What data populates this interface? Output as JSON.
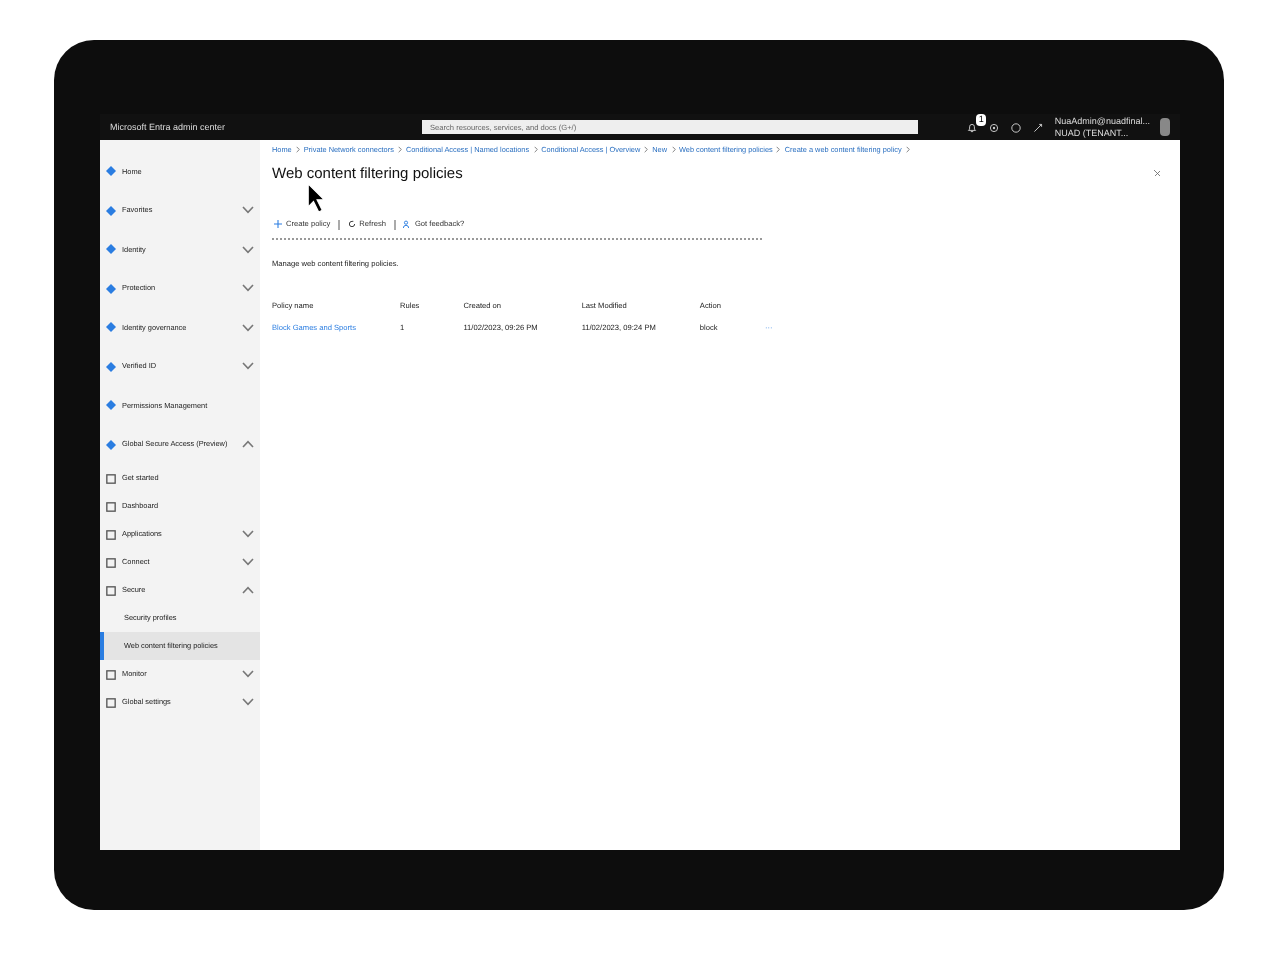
{
  "header": {
    "title": "Microsoft Entra admin center",
    "search": {
      "placeholder": "Search resources, services, and docs (G+/)"
    },
    "notification_count": "1",
    "account": {
      "name": "NuaAdmin@nuadfinal...",
      "tenant": "NUAD (TENANT..."
    }
  },
  "sidebar": {
    "items": [
      {
        "label": "Home",
        "selected": false
      },
      {
        "label": "Favorites",
        "selected": false,
        "expanded": false
      },
      {
        "label": "Identity",
        "selected": false,
        "expanded": false
      },
      {
        "label": "Protection",
        "selected": false,
        "expanded": false
      },
      {
        "label": "Identity governance",
        "selected": false,
        "expanded": false
      },
      {
        "label": "Verified ID",
        "selected": false,
        "expanded": false
      },
      {
        "label": "Permissions Management",
        "selected": false
      },
      {
        "label": "Global Secure Access (Preview)",
        "selected": false,
        "expanded": true,
        "children": [
          {
            "label": "Get started",
            "selected": false
          },
          {
            "label": "Dashboard",
            "selected": false
          },
          {
            "label": "Applications",
            "selected": false,
            "expanded": false
          },
          {
            "label": "Connect",
            "selected": false,
            "expanded": false
          },
          {
            "label": "Secure",
            "selected": false,
            "expanded": true,
            "children": [
              {
                "label": "Security profiles",
                "selected": false
              },
              {
                "label": "Web content filtering policies",
                "selected": true
              }
            ]
          },
          {
            "label": "Monitor",
            "selected": false,
            "expanded": false
          },
          {
            "label": "Global settings",
            "selected": false,
            "expanded": false
          }
        ]
      }
    ]
  },
  "breadcrumb": [
    "Home",
    "Private Network connectors",
    "Conditional Access | Named locations",
    "Conditional Access | Overview",
    "New",
    "Web content filtering policies",
    "Create a web content filtering policy"
  ],
  "page": {
    "title": "Web content filtering policies",
    "toolbar": [
      "Create policy",
      "Refresh",
      "Got feedback?"
    ],
    "description": "Manage web content filtering policies.",
    "table": {
      "columns": [
        "Policy name",
        "Rules",
        "Created on",
        "Last Modified",
        "Action"
      ],
      "rows": [
        {
          "cells": [
            "Block Games and Sports",
            "1",
            "11/02/2023, 09:26 PM",
            "11/02/2023, 09:24 PM",
            "block"
          ],
          "more": "···"
        }
      ]
    }
  }
}
